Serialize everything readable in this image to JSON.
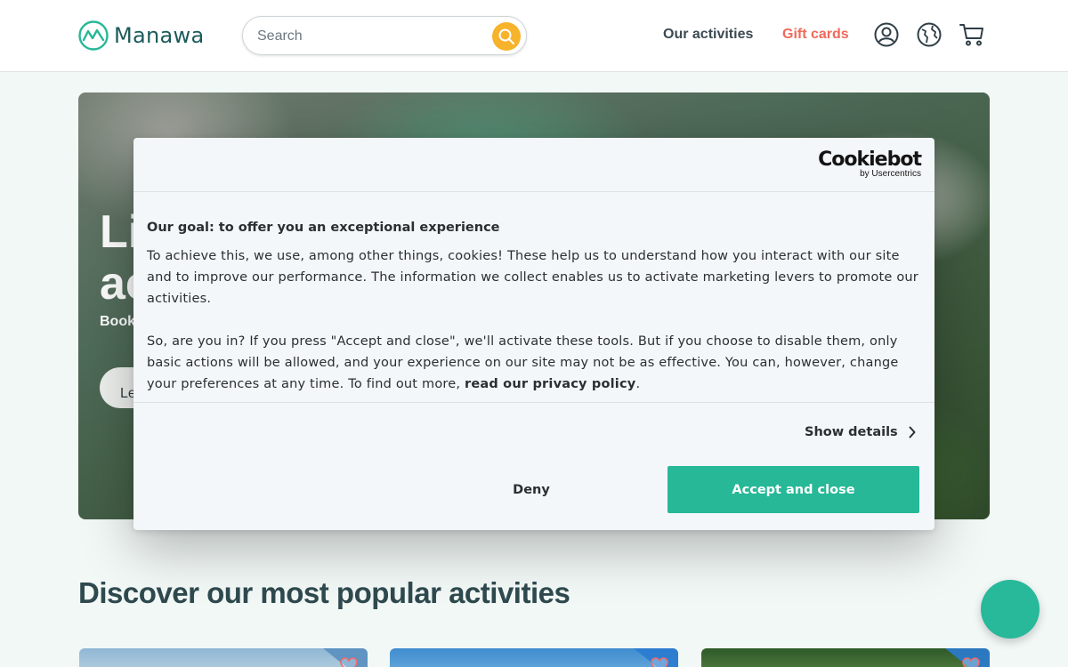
{
  "header": {
    "logo_text": "Manawa",
    "search": {
      "placeholder": "Search"
    },
    "nav": {
      "activities": "Our activities",
      "gift_cards": "Gift cards"
    }
  },
  "hero": {
    "title_line1": "Live",
    "title_line2": "ac",
    "subtitle": "Book",
    "button_label": "Le"
  },
  "popular": {
    "title": "Discover our most popular activities"
  },
  "cookie_dialog": {
    "logo": {
      "main": "Cookiebot",
      "sub": "by Usercentrics"
    },
    "heading": "Our goal: to offer you an exceptional experience",
    "paragraph1": "To achieve this, we use, among other things, cookies! These help us to understand how you interact with our site and to improve our performance. The information we collect enables us to activate marketing levers to promote our activities.",
    "paragraph2_text": "So, are you in? If you press \"Accept and close\", we'll activate these tools. But if you choose to disable them, only basic actions will be allowed, and your experience on our site may not be as effective. You can, however, change your preferences at any time. To find out more, ",
    "paragraph2_link": "read our privacy policy",
    "paragraph2_end": ".",
    "show_details": "Show details",
    "deny": "Deny",
    "accept": "Accept and close"
  },
  "colors": {
    "brand_teal": "#26b897",
    "gift_cards_red": "#f06a5a",
    "search_button_yellow": "#f7b32b",
    "title_dark": "#2f4a4f"
  }
}
